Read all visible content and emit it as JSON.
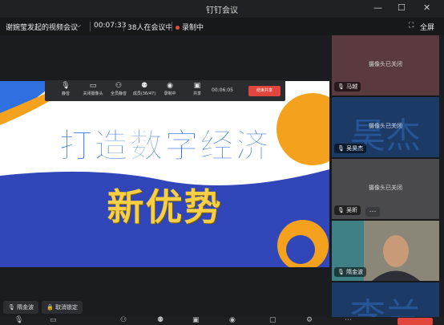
{
  "window": {
    "title": "钉钉会议",
    "fullscreen_label": "全屏"
  },
  "infobar": {
    "meeting_name": "谢婉莹发起的视频会议",
    "duration": "00:07:33",
    "participants": "38人在会议中",
    "recording": "录制中"
  },
  "share_toolbar": {
    "mute": "静音",
    "camera": "关闭摄像头",
    "mute_all": "全员静音",
    "members": "成员(36/47)",
    "record": "录制中",
    "share": "共享",
    "timer": "00:06:05",
    "end_share": "结束共享"
  },
  "slide": {
    "line1": "打造数字经济",
    "line2": "新优势"
  },
  "participants": [
    {
      "name": "马越",
      "status": "摄像头已关闭"
    },
    {
      "name": "吴昊杰",
      "status": "摄像头已关闭",
      "avatar_text": "昊杰"
    },
    {
      "name": "吴昕",
      "status": "摄像头已关闭"
    },
    {
      "name": "隋金波",
      "status": ""
    },
    {
      "name": "",
      "status": "",
      "avatar_text": "李兰"
    }
  ],
  "bottom": {
    "speaker": "隋金波",
    "unlock": "取消锁定"
  },
  "colors": {
    "accent_blue": "#2f6fe0",
    "accent_yellow": "#f6cf45",
    "active_border": "#3fbf5f",
    "record_red": "#e74c3c"
  }
}
